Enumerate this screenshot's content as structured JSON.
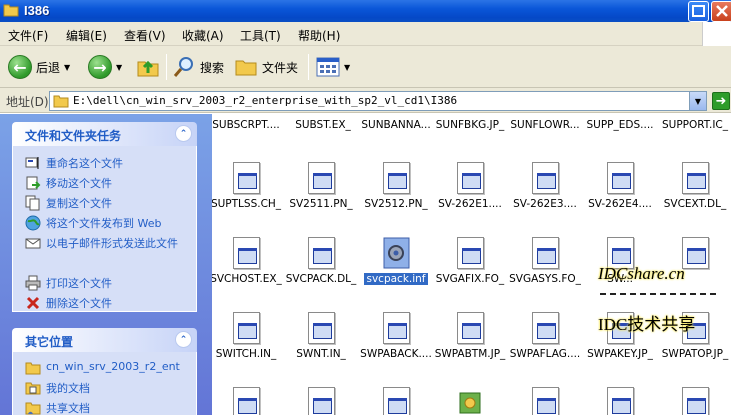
{
  "window": {
    "title": "I386"
  },
  "menu": {
    "items": [
      "文件(F)",
      "编辑(E)",
      "查看(V)",
      "收藏(A)",
      "工具(T)",
      "帮助(H)"
    ]
  },
  "toolbar": {
    "back_label": "后退",
    "search_label": "搜索",
    "folders_label": "文件夹"
  },
  "address": {
    "label": "地址(D)",
    "value": "E:\\dell\\cn_win_srv_2003_r2_enterprise_with_sp2_vl_cd1\\I386"
  },
  "tasks_panel": {
    "title": "文件和文件夹任务",
    "items": [
      {
        "label": "重命名这个文件",
        "icon": "rename-icon"
      },
      {
        "label": "移动这个文件",
        "icon": "move-icon"
      },
      {
        "label": "复制这个文件",
        "icon": "copy-icon"
      },
      {
        "label": "将这个文件发布到 Web",
        "icon": "web-publish-icon"
      },
      {
        "label": "以电子邮件形式发送此文件",
        "icon": "email-icon"
      },
      {
        "label": "打印这个文件",
        "icon": "print-icon"
      },
      {
        "label": "删除这个文件",
        "icon": "delete-icon"
      }
    ]
  },
  "places_panel": {
    "title": "其它位置",
    "items": [
      {
        "label": "cn_win_srv_2003_r2_ent",
        "icon": "folder-icon"
      },
      {
        "label": "我的文档",
        "icon": "my-documents-icon"
      },
      {
        "label": "共享文档",
        "icon": "shared-documents-icon"
      }
    ]
  },
  "files": {
    "row0": [
      "SUBSCRPT....",
      "SUBST.EX_",
      "SUNBANNA...",
      "SUNFBKG.JP_",
      "SUNFLOWR...",
      "SUPP_EDS....",
      "SUPPORT.IC_"
    ],
    "row1": [
      "SUPTLSS.CH_",
      "SV2511.PN_",
      "SV2512.PN_",
      "SV-262E1....",
      "SV-262E3....",
      "SV-262E4....",
      "SVCEXT.DL_"
    ],
    "row2": [
      "SVCHOST.EX_",
      "SVCPACK.DL_",
      "svcpack.inf",
      "SVGAFIX.FO_",
      "SVGASYS.FO_",
      "SW...",
      ""
    ],
    "row3": [
      "SWITCH.IN_",
      "SWNT.IN_",
      "SWPABACK....",
      "SWPABTM.JP_",
      "SWPAFLAG....",
      "SWPAKEY.JP_",
      "SWPATOP.JP_"
    ],
    "selected": "svcpack.inf"
  },
  "watermark": {
    "line1": "IDCshare.cn",
    "line2": "IDC技术共享"
  }
}
